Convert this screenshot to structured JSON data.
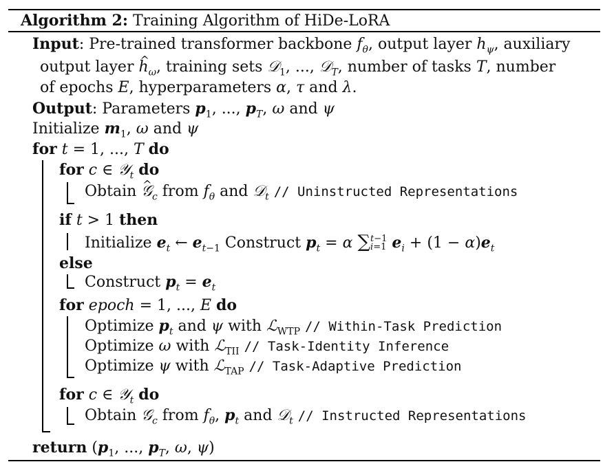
{
  "header": {
    "algorithm_label": "Algorithm 2:",
    "title": "Training Algorithm of HiDe-LoRA"
  },
  "input": {
    "label": "Input",
    "line1": ": Pre-trained transformer backbone f",
    "line2": "output layer h",
    "line3": "of epochs E, hyperparameters α, τ and λ."
  },
  "output": {
    "label": "Output",
    "text": ": Parameters p",
    "rest": ", ω and ψ"
  },
  "init": {
    "text": "Initialize m",
    "rest": ", ω and ψ"
  },
  "keywords": {
    "for": "for",
    "do": "do",
    "if": "if",
    "then": "then",
    "else": "else",
    "return": "return"
  },
  "comments": {
    "uninstructed": "// Uninstructed Representations",
    "wtp": "// Within-Task Prediction",
    "tii": "// Task-Identity Inference",
    "tap": "// Task-Adaptive Prediction",
    "instructed": "// Instructed Representations"
  },
  "text": {
    "obtain": "Obtain",
    "from": "from",
    "and": "and",
    "initialize": "Initialize",
    "construct": "Construct",
    "optimize": "Optimize",
    "with": "with"
  }
}
